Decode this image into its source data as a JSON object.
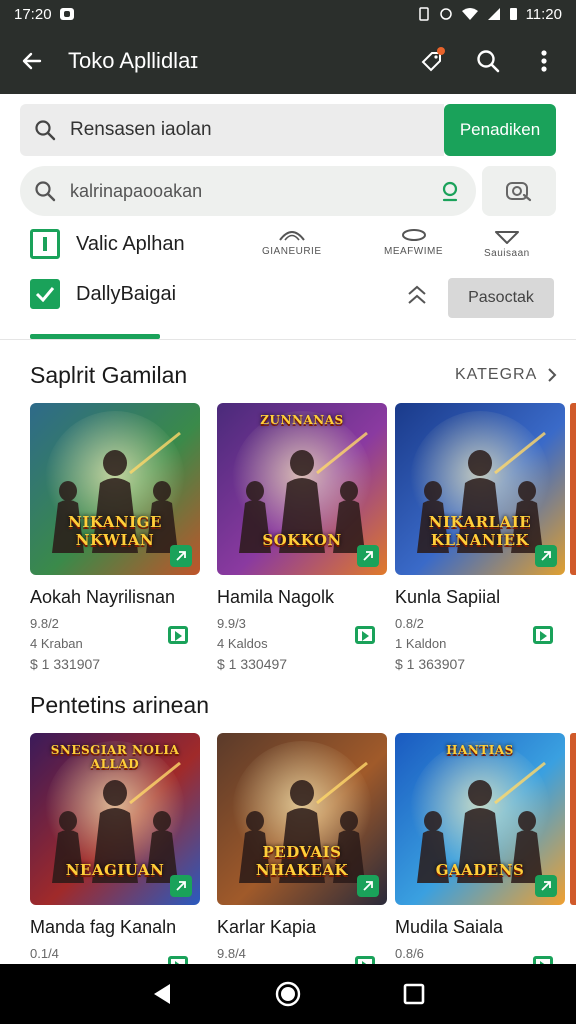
{
  "status_bar": {
    "time_left": "17:20",
    "time_right": "11:20"
  },
  "toolbar": {
    "title": "Toko Apllidlaɪ"
  },
  "search_primary": {
    "placeholder": "Rensasen iaolan",
    "button_label": "Penadiken"
  },
  "search_secondary": {
    "placeholder": "kalrinapaooakan"
  },
  "filters": {
    "row1_label": "Valic Aplhan",
    "row2_label": "DallyBaigai",
    "categories": [
      "GIANEURIE",
      "MEAFWIME",
      "Sauisaan"
    ],
    "pasok_button": "Pasoctak"
  },
  "sections": [
    {
      "title": "Saplrit Gamilan",
      "more_label": "KATEGRA",
      "apps": [
        {
          "thumb_text": "NIKANIGE NKWIAN",
          "name": "Aokah Nayrilisnan",
          "rating": "9.8/2",
          "size": "4 Kraban",
          "price": "$ 1 331907",
          "thumb_colors": [
            "#2e6a8a",
            "#3a8a4a",
            "#c0542a"
          ]
        },
        {
          "thumb_text": "SOKKON",
          "top_text": "ZUNNANAS",
          "name": "Hamila Nagolk",
          "rating": "9.9/3",
          "size": "4 Kaldos",
          "price": "$ 1 330497",
          "thumb_colors": [
            "#4a2a7a",
            "#8a3aa0",
            "#e07a2a"
          ]
        },
        {
          "thumb_text": "NIKARLAIE KLNANIEK",
          "name": "Kunla Sapiial",
          "rating": "0.8/2",
          "size": "1 Kaldon",
          "price": "$ 1 363907",
          "thumb_colors": [
            "#1a3a8a",
            "#3a6ac8",
            "#e0a030"
          ]
        }
      ]
    },
    {
      "title": "Pentetins arinean",
      "apps": [
        {
          "thumb_text": "NEAGIUAN",
          "top_text": "SNESGIAR NOLIA ALLAD",
          "name": "Manda fag Kanaln",
          "rating": "0.1/4",
          "size": "",
          "price": "",
          "thumb_colors": [
            "#3a1a5a",
            "#a02a2a",
            "#2a5ac0"
          ]
        },
        {
          "thumb_text": "PEDVAIS NHAKEAK",
          "name": "Karlar Kapia",
          "rating": "9.8/4",
          "size": "",
          "price": "",
          "thumb_colors": [
            "#5a3a2a",
            "#a05a2a",
            "#2a2a3a"
          ]
        },
        {
          "thumb_text": "GAADENS",
          "top_text": "HANTIAS",
          "name": "Mudila Saiala",
          "rating": "0.8/6",
          "size": "",
          "price": "",
          "thumb_colors": [
            "#1a5ac0",
            "#3aa0e0",
            "#f0a030"
          ]
        }
      ]
    }
  ],
  "nav": {
    "back": "back-icon",
    "home": "home-icon",
    "recents": "recents-icon"
  }
}
